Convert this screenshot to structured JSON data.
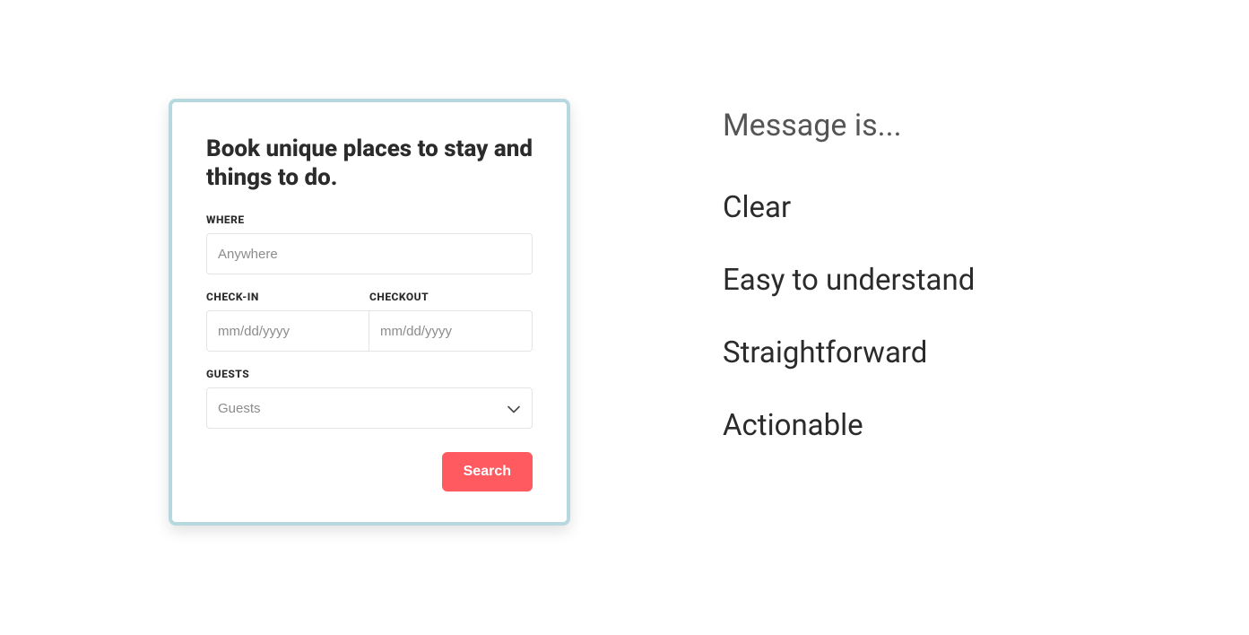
{
  "card": {
    "title": "Book unique places to stay and things to do.",
    "where": {
      "label": "WHERE",
      "placeholder": "Anywhere"
    },
    "checkin": {
      "label": "CHECK-IN",
      "placeholder": "mm/dd/yyyy"
    },
    "checkout": {
      "label": "CHECKOUT",
      "placeholder": "mm/dd/yyyy"
    },
    "guests": {
      "label": "GUESTS",
      "placeholder": "Guests"
    },
    "search_button": "Search"
  },
  "annotations": {
    "heading": "Message is...",
    "items": [
      "Clear",
      "Easy to understand",
      "Straightforward",
      "Actionable"
    ]
  }
}
